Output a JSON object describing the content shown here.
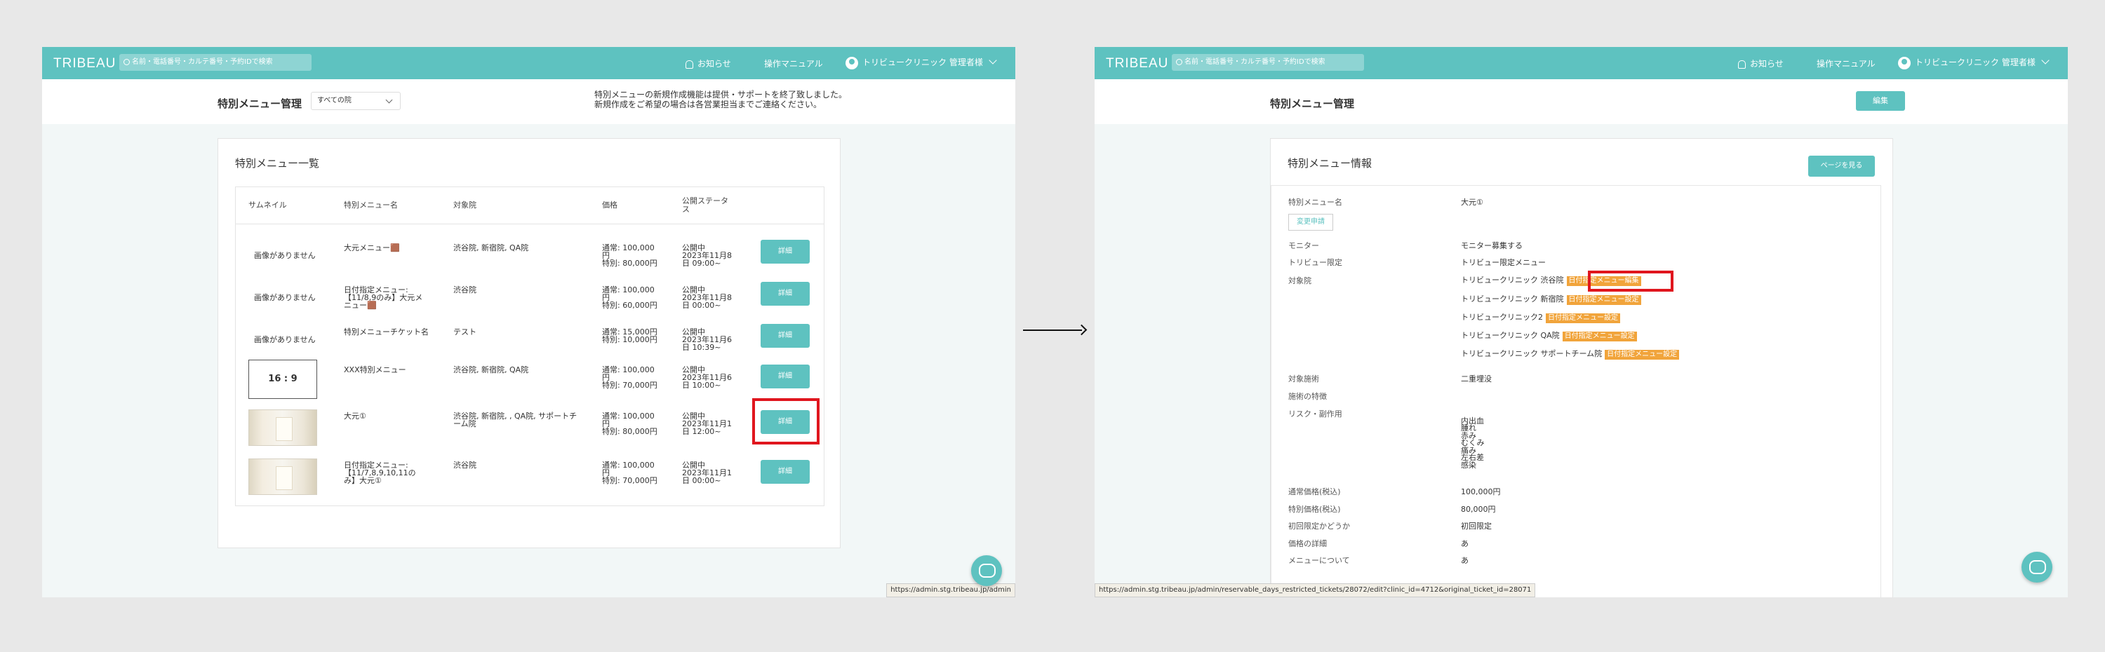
{
  "app": {
    "logo": "TRIBEAU",
    "search_placeholder": "名前・電話番号・カルテ番号・予約IDで検索",
    "notice_label": "お知らせ",
    "manual_label": "操作マニュアル",
    "user_name": "トリビュークリニック 管理者様",
    "accent_color": "#5ec2c0",
    "tag_color": "#f1a43b"
  },
  "left": {
    "page_title": "特別メニュー管理",
    "clinic_select": "すべての院",
    "notice": [
      "特別メニューの新規作成機能は提供・サポートを終了致しました。",
      "新規作成をご希望の場合は各営業担当までご連絡ください。"
    ],
    "card_title": "特別メニュー一覧",
    "headers": [
      "サムネイル",
      "特別メニュー名",
      "対象院",
      "価格",
      "公開ステータス"
    ],
    "rows": [
      {
        "thumb": "画像がありません",
        "name": [
          "大元メニュー🟫"
        ],
        "clinics": [
          "渋谷院, 新宿院, QA院"
        ],
        "price": [
          "通常: 100,000",
          "円",
          "特別: 80,000円"
        ],
        "status": [
          "公開中",
          "2023年11月8",
          "日 09:00~"
        ],
        "button": "詳細"
      },
      {
        "thumb": "画像がありません",
        "name": [
          "日付指定メニュー:",
          "【11/8,9のみ】大元メ",
          "ニュー🟫"
        ],
        "clinics": [
          "渋谷院"
        ],
        "price": [
          "通常: 100,000",
          "円",
          "特別: 60,000円"
        ],
        "status": [
          "公開中",
          "2023年11月8",
          "日 00:00~"
        ],
        "button": "詳細"
      },
      {
        "thumb": "画像がありません",
        "name": [
          "特別メニューチケット名"
        ],
        "clinics": [
          "テスト"
        ],
        "price": [
          "通常: 15,000円",
          "特別: 10,000円"
        ],
        "status": [
          "公開中",
          "2023年11月6",
          "日 10:39~"
        ],
        "button": "詳細"
      },
      {
        "thumb": "16 : 9",
        "name": [
          "XXX特別メニュー"
        ],
        "clinics": [
          "渋谷院, 新宿院, QA院"
        ],
        "price": [
          "通常: 100,000",
          "円",
          "特別: 70,000円"
        ],
        "status": [
          "公開中",
          "2023年11月6",
          "日 10:00~"
        ],
        "button": "詳細"
      },
      {
        "thumb": "photo",
        "name": [
          "大元①"
        ],
        "clinics": [
          "渋谷院, 新宿院, , QA院, サポートチ",
          "ーム院"
        ],
        "price": [
          "通常: 100,000",
          "円",
          "特別: 80,000円"
        ],
        "status": [
          "公開中",
          "2023年11月1",
          "日 12:00~"
        ],
        "button": "詳細"
      },
      {
        "thumb": "photo",
        "name": [
          "日付指定メニュー:",
          "【11/7,8,9,10,11の",
          "み】大元①"
        ],
        "clinics": [
          "渋谷院"
        ],
        "price": [
          "通常: 100,000",
          "円",
          "特別: 70,000円"
        ],
        "status": [
          "公開中",
          "2023年11月1",
          "日 00:00~"
        ],
        "button": "詳細"
      }
    ],
    "status_url": "https://admin.stg.tribeau.jp/admin"
  },
  "right": {
    "page_title": "特別メニュー管理",
    "edit_button": "編集",
    "card_title": "特別メニュー情報",
    "view_page_button": "ページを見る",
    "change_request_button": "変更申請",
    "fields": [
      {
        "label": "特別メニュー名",
        "value": [
          "大元①"
        ]
      },
      {
        "label": "モニター",
        "value": [
          "モニター募集する"
        ]
      },
      {
        "label": "トリビュー限定",
        "value": [
          "トリビュー限定メニュー"
        ]
      },
      {
        "label": "対象院",
        "value": []
      },
      {
        "label": "対象施術",
        "value": [
          "二重埋没"
        ]
      },
      {
        "label": "施術の特徴",
        "value": []
      },
      {
        "label": "リスク・副作用",
        "value": [
          "",
          "内出血",
          "腫れ",
          "赤み",
          "むくみ",
          "痛み",
          "左右差",
          "感染"
        ]
      },
      {
        "label": "通常価格(税込)",
        "value": [
          "100,000円"
        ]
      },
      {
        "label": "特別価格(税込)",
        "value": [
          "80,000円"
        ]
      },
      {
        "label": "初回限定かどうか",
        "value": [
          "初回限定"
        ]
      },
      {
        "label": "価格の詳細",
        "value": [
          "あ"
        ]
      },
      {
        "label": "メニューについて",
        "value": [
          "あ"
        ]
      }
    ],
    "clinics": [
      {
        "name": "トリビュークリニック 渋谷院",
        "tag": "日付指定メニュー編集"
      },
      {
        "name": "トリビュークリニック 新宿院",
        "tag": "日付指定メニュー設定"
      },
      {
        "name": "トリビュークリニック2",
        "tag": "日付指定メニュー設定"
      },
      {
        "name": "トリビュークリニック QA院",
        "tag": "日付指定メニュー設定"
      },
      {
        "name": "トリビュークリニック サポートチーム院",
        "tag": "日付指定メニュー設定"
      }
    ],
    "status_url": "https://admin.stg.tribeau.jp/admin/reservable_days_restricted_tickets/28072/edit?clinic_id=4712&original_ticket_id=28071"
  }
}
